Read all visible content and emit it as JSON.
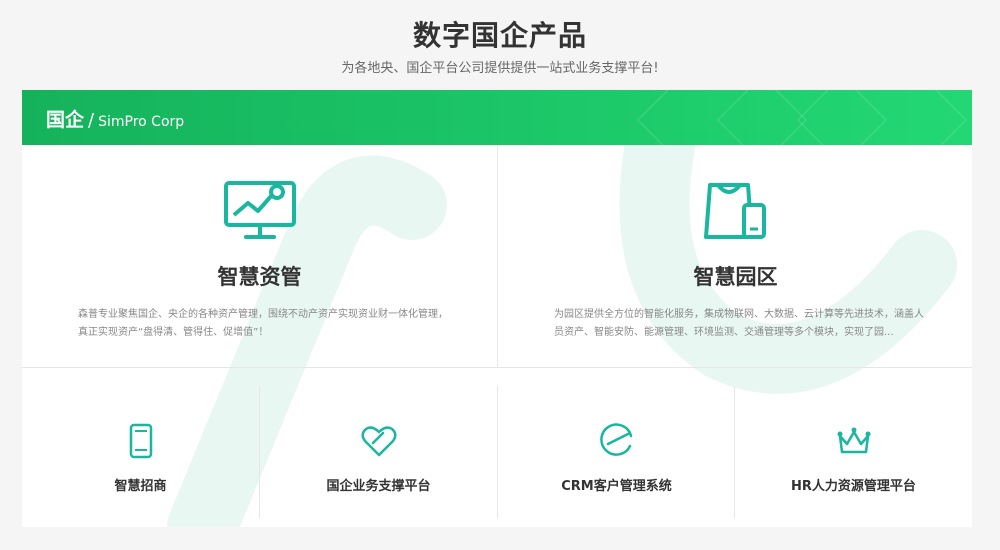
{
  "header": {
    "title": "数字国企产品",
    "subtitle": "为各地央、国企平台公司提供提供一站式业务支撑平台!"
  },
  "banner": {
    "main": "国企",
    "separator": "/",
    "sub": "SimPro Corp"
  },
  "features": [
    {
      "name": "智慧资管",
      "icon": "monitor-chart-icon",
      "description": "森普专业聚焦国企、央企的各种资产管理，围绕不动产资产实现资业财一体化管理，真正实现资产“盘得清、管得住、促增值”！"
    },
    {
      "name": "智慧园区",
      "icon": "building-phone-icon",
      "description": "为园区提供全方位的智能化服务，集成物联网、大数据、云计算等先进技术，涵盖人员资产、智能安防、能源管理、环境监测、交通管理等多个模块，实现了园..."
    }
  ],
  "products": [
    {
      "name": "智慧招商",
      "icon": "tablet-icon"
    },
    {
      "name": "国企业务支撑平台",
      "icon": "heart-icon"
    },
    {
      "name": "CRM客户管理系统",
      "icon": "e-circle-icon"
    },
    {
      "name": "HR人力资源管理平台",
      "icon": "crown-icon"
    }
  ],
  "colors": {
    "accent": "#1cc768",
    "icon": "#19b6a0"
  }
}
